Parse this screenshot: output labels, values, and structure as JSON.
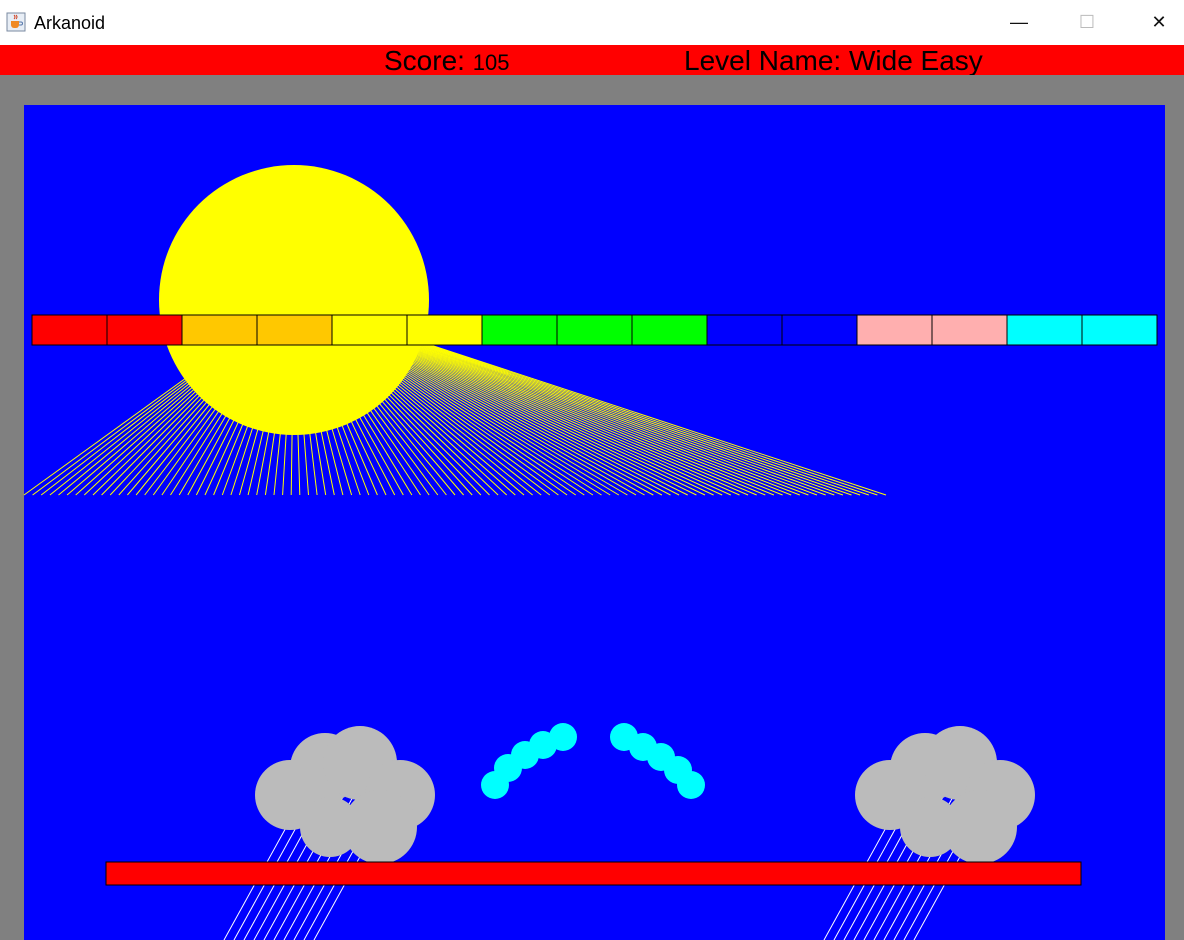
{
  "window": {
    "title": "Arkanoid",
    "minimize_glyph": "—",
    "maximize_glyph": "☐",
    "close_glyph": "✕"
  },
  "hud": {
    "score_label": "Score:",
    "score_value": "105",
    "level_label": "Level Name:",
    "level_name": "Wide Easy"
  },
  "colors": {
    "hud_bg": "#ff0000",
    "frame": "#808080",
    "sky": "#0000ff",
    "sun": "#ffff00",
    "cloud": "#bbbbbb",
    "ball": "#00ffff",
    "paddle": "#ff0000"
  },
  "blocks": [
    {
      "color": "#ff0000"
    },
    {
      "color": "#ff0000"
    },
    {
      "color": "#ffc800"
    },
    {
      "color": "#ffc800"
    },
    {
      "color": "#ffff00"
    },
    {
      "color": "#ffff00"
    },
    {
      "color": "#00ff00"
    },
    {
      "color": "#00ff00"
    },
    {
      "color": "#00ff00"
    },
    {
      "color": "#0000ff"
    },
    {
      "color": "#0000ff"
    },
    {
      "color": "#ffafaf"
    },
    {
      "color": "#ffafaf"
    },
    {
      "color": "#00ffff"
    },
    {
      "color": "#00ffff"
    }
  ],
  "balls_count": 10
}
